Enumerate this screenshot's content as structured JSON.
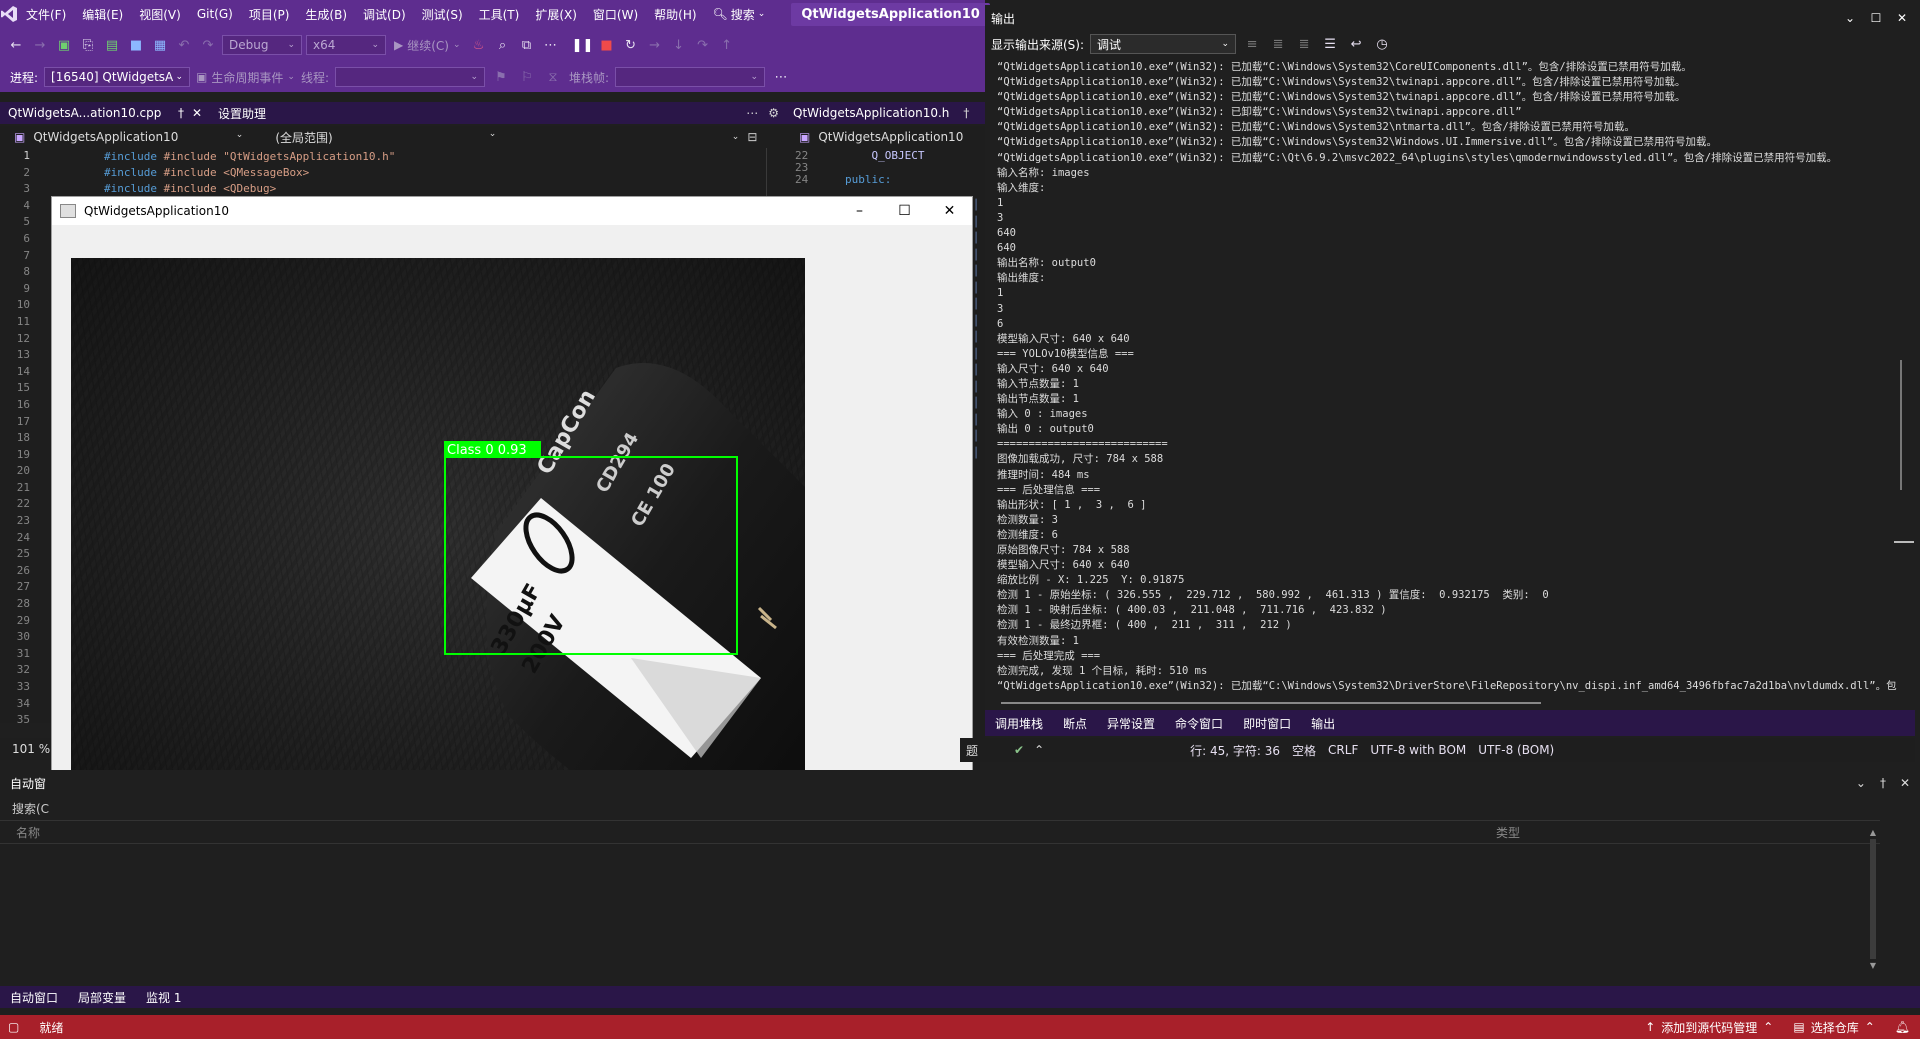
{
  "menubar": {
    "items": [
      "文件(F)",
      "编辑(E)",
      "视图(V)",
      "Git(G)",
      "项目(P)",
      "生成(B)",
      "调试(D)",
      "测试(S)",
      "工具(T)",
      "扩展(X)",
      "窗口(W)",
      "帮助(H)"
    ],
    "search_label": "搜索",
    "solution_title": "QtWidgetsApplication10"
  },
  "toolbar": {
    "config": "Debug",
    "platform": "x64",
    "continue_label": "继续(C)"
  },
  "debug_toolbar": {
    "process_label": "进程:",
    "process_value": "[16540] QtWidgetsA",
    "lifecycle_label": "生命周期事件",
    "thread_label": "线程:",
    "stack_label": "堆栈帧:"
  },
  "left_editor": {
    "tab1": "QtWidgetsA...ation10.cpp",
    "tab2": "设置助理",
    "scope1": "QtWidgetsApplication10",
    "scope2": "(全局范围)",
    "code_lines": [
      "#include \"QtWidgetsApplication10.h\"",
      "#include <QMessageBox>",
      "#include <QDebug>"
    ],
    "zoom": "101 %"
  },
  "right_editor": {
    "tab": "QtWidgetsApplication10.h",
    "scope": "QtWidgetsApplication10",
    "line_nums": [
      "22",
      "23",
      "24"
    ],
    "code_lines": [
      "    Q_OBJECT",
      "",
      "public:"
    ]
  },
  "qt_window": {
    "title": "QtWidgetsApplication10",
    "detection_label": "Class 0 0.93",
    "cap_text": [
      "CapCon",
      "CD294",
      "CE 100",
      "330μF",
      "200V"
    ]
  },
  "output_panel": {
    "title": "输出",
    "source_label": "显示输出来源(S):",
    "source_value": "调试",
    "lines": [
      "“QtWidgetsApplication10.exe”(Win32): 已加载“C:\\Windows\\System32\\CoreUIComponents.dll”。包含/排除设置已禁用符号加载。",
      "“QtWidgetsApplication10.exe”(Win32): 已加载“C:\\Windows\\System32\\twinapi.appcore.dll”。包含/排除设置已禁用符号加载。",
      "“QtWidgetsApplication10.exe”(Win32): 已加载“C:\\Windows\\System32\\twinapi.appcore.dll”。包含/排除设置已禁用符号加载。",
      "“QtWidgetsApplication10.exe”(Win32): 已卸载“C:\\Windows\\System32\\twinapi.appcore.dll”",
      "“QtWidgetsApplication10.exe”(Win32): 已加载“C:\\Windows\\System32\\ntmarta.dll”。包含/排除设置已禁用符号加载。",
      "“QtWidgetsApplication10.exe”(Win32): 已加载“C:\\Windows\\System32\\Windows.UI.Immersive.dll”。包含/排除设置已禁用符号加载。",
      "“QtWidgetsApplication10.exe”(Win32): 已加载“C:\\Qt\\6.9.2\\msvc2022_64\\plugins\\styles\\qmodernwindowsstyled.dll”。包含/排除设置已禁用符号加载。",
      "输入名称: images",
      "输入维度:",
      "1",
      "3",
      "640",
      "640",
      "输出名称: output0",
      "输出维度:",
      "1",
      "3",
      "6",
      "模型输入尺寸: 640 x 640",
      "=== YOLOv10模型信息 ===",
      "输入尺寸: 640 x 640",
      "输入节点数量: 1",
      "输出节点数量: 1",
      "输入 0 : images",
      "输出 0 : output0",
      "===========================",
      "图像加载成功, 尺寸: 784 x 588",
      "推理时间: 484 ms",
      "=== 后处理信息 ===",
      "输出形状: [ 1 ,  3 ,  6 ]",
      "检测数量: 3",
      "检测维度: 6",
      "原始图像尺寸: 784 x 588",
      "模型输入尺寸: 640 x 640",
      "缩放比例 - X: 1.225  Y: 0.91875",
      "检测 1 - 原始坐标: ( 326.555 ,  229.712 ,  580.992 ,  461.313 ) 置信度:  0.932175  类别:  0",
      "检测 1 - 映射后坐标: ( 400.03 ,  211.048 ,  711.716 ,  423.832 )",
      "检测 1 - 最终边界框: ( 400 ,  211 ,  311 ,  212 )",
      "有效检测数量: 1",
      "=== 后处理完成 ===",
      "检测完成, 发现 1 个目标, 耗时: 510 ms",
      "“QtWidgetsApplication10.exe”(Win32): 已加载“C:\\Windows\\System32\\DriverStore\\FileRepository\\nv_dispi.inf_amd64_3496fbfac7a2d1ba\\nvldumdx.dll”。包含"
    ],
    "tabs": [
      "调用堆栈",
      "断点",
      "异常设置",
      "命令窗口",
      "即时窗口",
      "输出"
    ]
  },
  "editor_status": {
    "label_issues": "题",
    "position": "行: 45, 字符: 36",
    "spaces": "空格",
    "line_ending": "CRLF",
    "encoding1": "UTF-8 with BOM",
    "encoding2": "UTF-8 (BOM)"
  },
  "autos_panel": {
    "title_partial": "自动窗",
    "search_partial": "搜索(C",
    "col_name": "名称",
    "col_type": "类型",
    "bottom_tabs": [
      "自动窗口",
      "局部变量",
      "监视 1"
    ]
  },
  "statusbar": {
    "ready": "就绪",
    "add_source": "添加到源代码管理",
    "select_repo": "选择仓库"
  },
  "colors": {
    "purple": "#5e2d8f",
    "status_bar": "#a8202a",
    "detection_green": "#00ff00"
  }
}
